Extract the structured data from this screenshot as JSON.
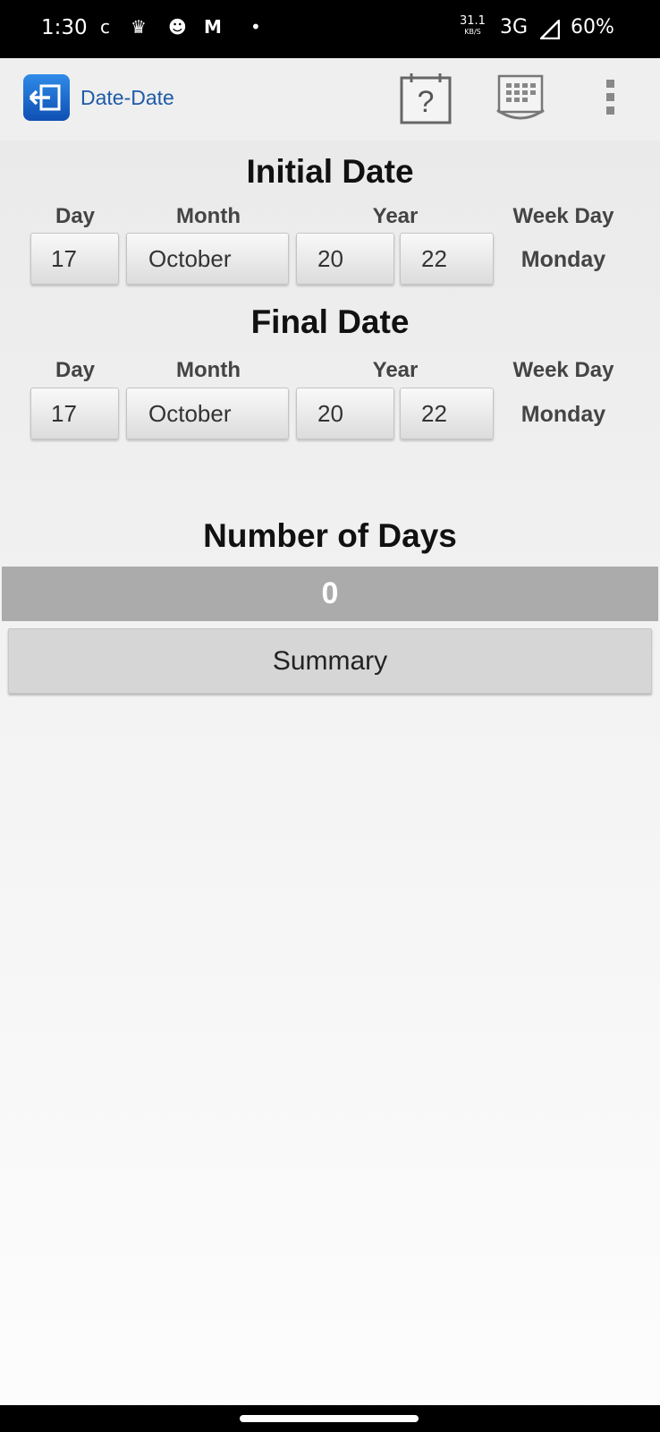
{
  "status_bar": {
    "time": "1:30",
    "icons": [
      "c-icon",
      "crown-icon",
      "reddit-icon",
      "m-icon",
      "dot-icon"
    ],
    "speed_value": "31.1",
    "speed_unit": "KB/S",
    "network": "3G",
    "battery": "60%"
  },
  "app_bar": {
    "title": "Date-Date",
    "actions": [
      "help-calendar-icon",
      "recurring-calendar-icon",
      "overflow-menu-icon"
    ]
  },
  "initial": {
    "title": "Initial Date",
    "labels": {
      "day": "Day",
      "month": "Month",
      "year": "Year",
      "weekday": "Week Day"
    },
    "day": "17",
    "month": "October",
    "year_century": "20",
    "year_decade": "22",
    "weekday": "Monday"
  },
  "final": {
    "title": "Final Date",
    "labels": {
      "day": "Day",
      "month": "Month",
      "year": "Year",
      "weekday": "Week Day"
    },
    "day": "17",
    "month": "October",
    "year_century": "20",
    "year_decade": "22",
    "weekday": "Monday"
  },
  "result": {
    "title": "Number of Days",
    "value": "0"
  },
  "summary_button": "Summary",
  "colors": {
    "title_blue": "#1f5ba8",
    "result_bar": "#ababab"
  }
}
